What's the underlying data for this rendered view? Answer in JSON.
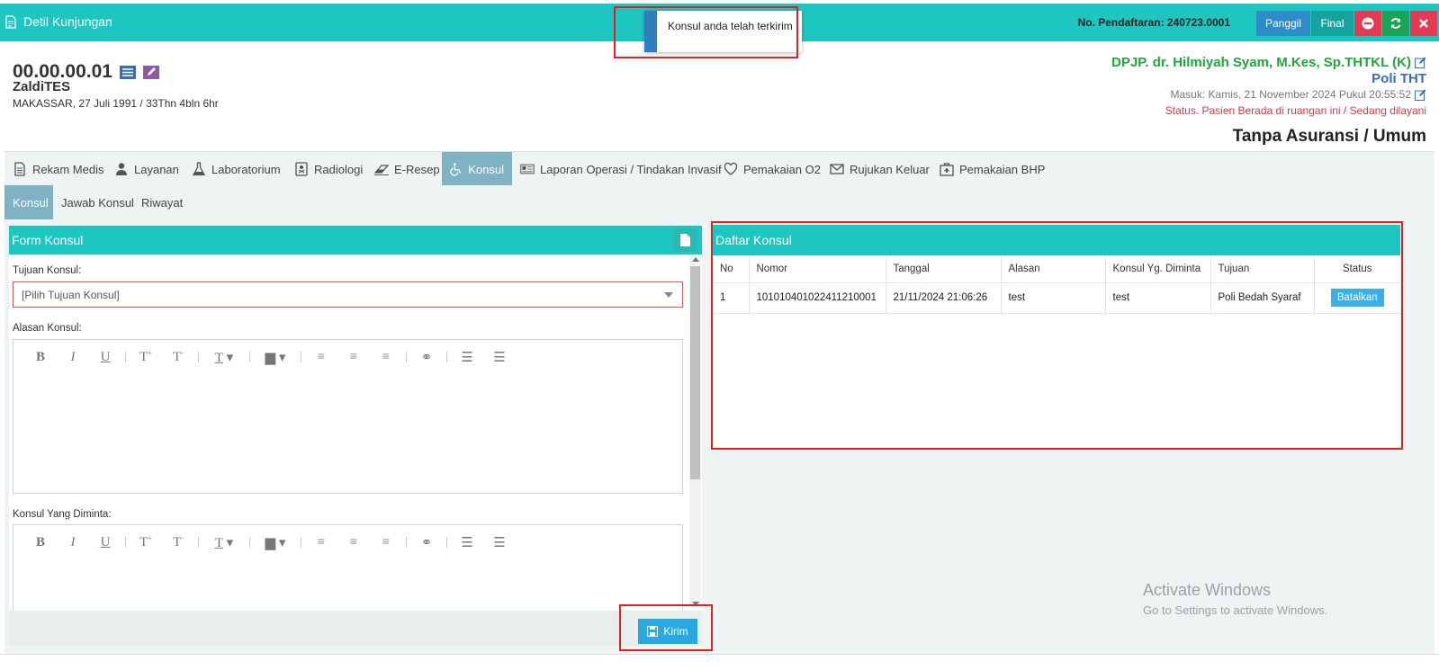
{
  "header": {
    "title": "Detil Kunjungan",
    "reg_label": "No. Pendaftaran: 240723.0001",
    "buttons": {
      "panggil": "Panggil",
      "final": "Final"
    },
    "icons": [
      "document-icon",
      "minus-circle-icon",
      "refresh-icon",
      "close-icon"
    ],
    "color": "#1ec6c1"
  },
  "toast": {
    "message": "Konsul anda telah terkirim"
  },
  "patient": {
    "id": "00.00.00.01",
    "name": "ZaldiTES",
    "birth": "MAKASSAR, 27 Juli 1991 / 33Thn 4bln 6hr"
  },
  "visit": {
    "doctor": "DPJP. dr. Hilmiyah Syam, M.Kes, Sp.THTKL (K)",
    "poli": "Poli THT",
    "masuk": "Masuk: Kamis, 21 November 2024 Pukul 20:55:52",
    "status": "Status. Pasien Berada di ruangan ini / Sedang dilayani",
    "asuransi": "Tanpa Asuransi / Umum"
  },
  "main_tabs": [
    {
      "label": "Rekam Medis",
      "icon": "file-text-icon"
    },
    {
      "label": "Layanan",
      "icon": "user-md-icon"
    },
    {
      "label": "Laboratorium",
      "icon": "flask-icon"
    },
    {
      "label": "Radiologi",
      "icon": "xray-icon"
    },
    {
      "label": "E-Resep",
      "icon": "eraser-icon"
    },
    {
      "label": "Konsul",
      "icon": "wheelchair-icon"
    },
    {
      "label": "Laporan Operasi / Tindakan Invasif",
      "icon": "newspaper-icon"
    },
    {
      "label": "Pemakaian O2",
      "icon": "heart-icon"
    },
    {
      "label": "Rujukan Keluar",
      "icon": "envelope-icon"
    },
    {
      "label": "Pemakaian BHP",
      "icon": "medkit-icon"
    }
  ],
  "sub_tabs": [
    "Konsul",
    "Jawab Konsul",
    "Riwayat"
  ],
  "form": {
    "title": "Form Konsul",
    "tujuan_label": "Tujuan Konsul:",
    "tujuan_value": "[Pilih Tujuan Konsul]",
    "alasan_label": "Alasan Konsul:",
    "diminta_label": "Konsul Yang Diminta:",
    "submit": "Kirim"
  },
  "list": {
    "title": "Daftar Konsul",
    "columns": [
      "No",
      "Nomor",
      "Tanggal",
      "Alasan",
      "Konsul Yg. Diminta",
      "Tujuan",
      "Status"
    ],
    "rows": [
      {
        "no": "1",
        "nomor": "101010401022411210001",
        "tanggal": "21/11/2024 21:06:26",
        "alasan": "test",
        "diminta": "test",
        "tujuan": "Poli Bedah Syaraf",
        "action": "Batalkan"
      }
    ]
  },
  "watermark": {
    "line1": "Activate Windows",
    "line2": "Go to Settings to activate Windows."
  }
}
